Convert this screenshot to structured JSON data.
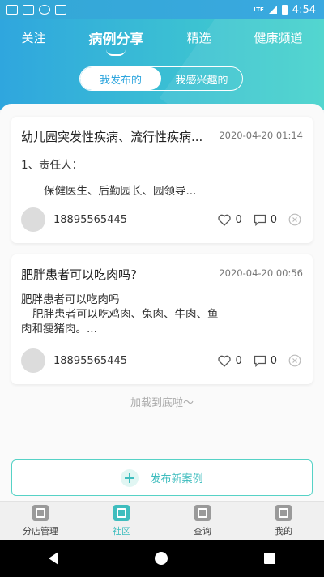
{
  "status": {
    "network": "LTE",
    "time": "4:54"
  },
  "nav": {
    "tabs": [
      {
        "label": "关注"
      },
      {
        "label": "病例分享"
      },
      {
        "label": "精选"
      },
      {
        "label": "健康频道"
      }
    ]
  },
  "segment": {
    "options": [
      "我发布的",
      "我感兴趣的"
    ]
  },
  "cards": [
    {
      "title": "幼儿园突发性疾病、流行性疾病...",
      "date": "2020-04-20 01:14",
      "body_line1": "1、责任人：",
      "body_line2": "保健医生、后勤园长、园领导...",
      "user": "18895565445",
      "likes": "0",
      "comments": "0"
    },
    {
      "title": "肥胖患者可以吃肉吗?",
      "date": "2020-04-20 00:56",
      "body_line1": "肥胖患者可以吃肉吗",
      "body_line2": "肥胖患者可以吃鸡肉、兔肉、牛肉、鱼",
      "body_line3": "肉和瘦猪肉。...",
      "user": "18895565445",
      "likes": "0",
      "comments": "0"
    }
  ],
  "loaded_text": "加载到底啦～",
  "publish_label": "发布新案例",
  "tabbar": {
    "items": [
      {
        "label": "分店管理"
      },
      {
        "label": "社区"
      },
      {
        "label": "查询"
      },
      {
        "label": "我的"
      }
    ]
  },
  "colors": {
    "header_start": "#2fa6de",
    "header_end": "#45d3cb",
    "accent": "#3fbdbe"
  }
}
